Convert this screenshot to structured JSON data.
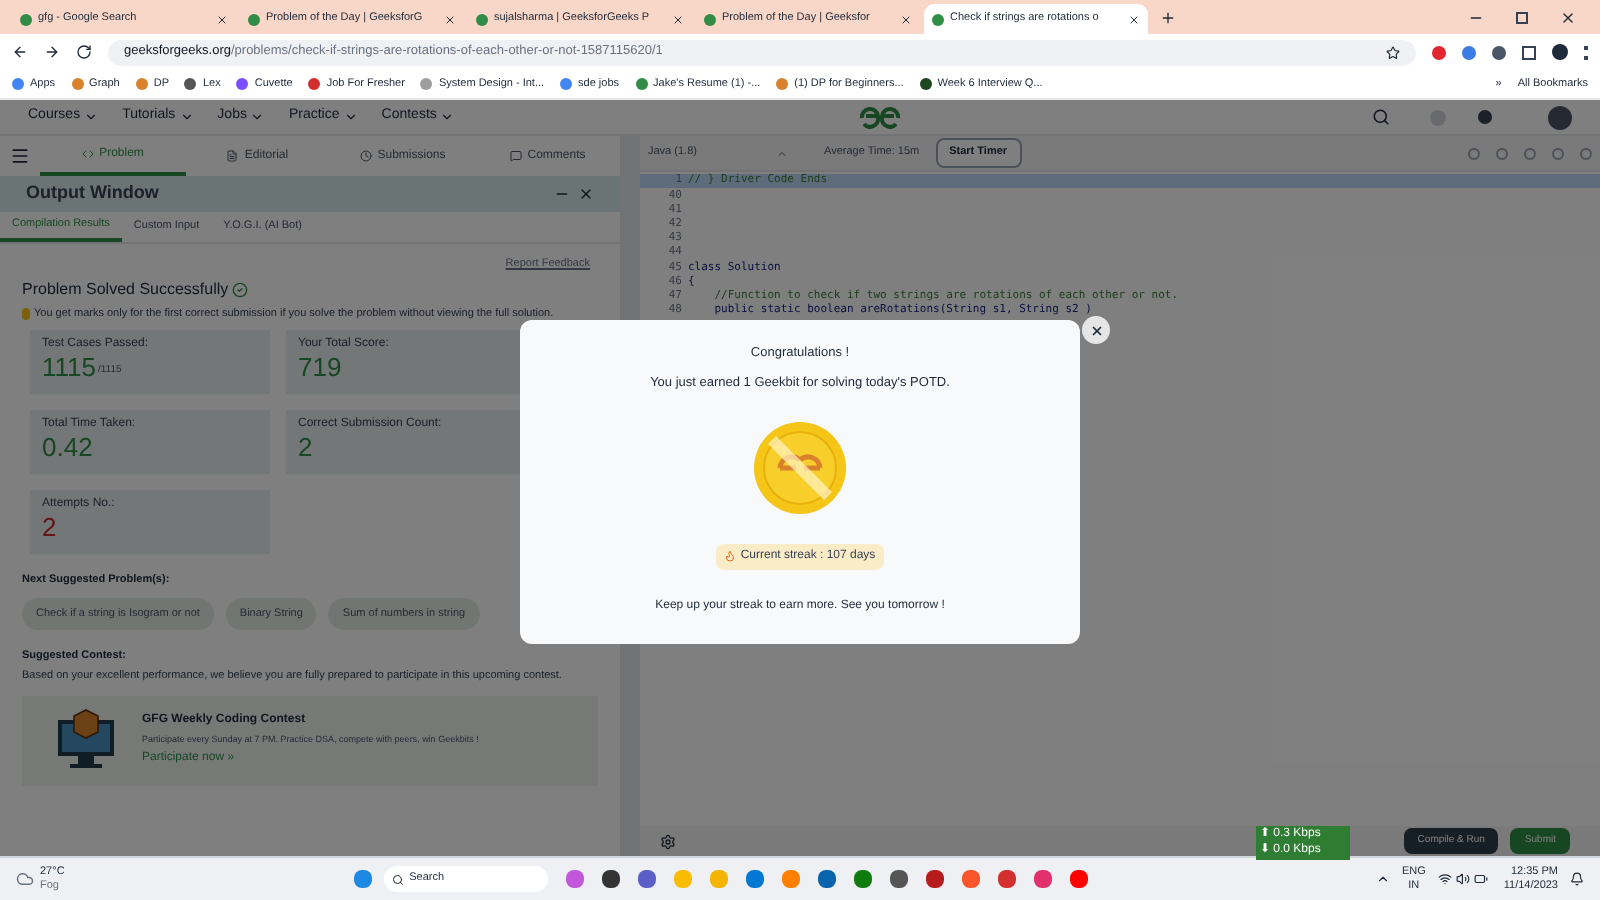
{
  "browser": {
    "tabs": [
      {
        "title": "gfg - Google Search",
        "selected": false
      },
      {
        "title": "Problem of the Day | GeeksforG",
        "selected": false
      },
      {
        "title": "sujalsharma | GeeksforGeeks P",
        "selected": false
      },
      {
        "title": "Problem of the Day | Geeksfor",
        "selected": false
      },
      {
        "title": "Check if strings are rotations o",
        "selected": true
      }
    ],
    "url_domain": "geeksforgeeks.org",
    "url_path": "/problems/check-if-strings-are-rotations-of-each-other-or-not-1587115620/1",
    "bookmarks": [
      {
        "label": "Apps",
        "color": "#4285f4"
      },
      {
        "label": "Graph",
        "color": "#d9822b"
      },
      {
        "label": "DP",
        "color": "#d9822b"
      },
      {
        "label": "Lex",
        "color": "#555555"
      },
      {
        "label": "Cuvette",
        "color": "#7c4dff"
      },
      {
        "label": "Job For Fresher",
        "color": "#d32f2f"
      },
      {
        "label": "System Design - Int...",
        "color": "#9e9e9e"
      },
      {
        "label": "sde jobs",
        "color": "#4285f4"
      },
      {
        "label": "Jake's Resume (1) -...",
        "color": "#2f8d46"
      },
      {
        "label": "(1) DP for Beginners...",
        "color": "#d9822b"
      },
      {
        "label": "Week 6 Interview Q...",
        "color": "#1e4620"
      }
    ],
    "more": "»",
    "all_bookmarks": "All Bookmarks"
  },
  "nav": {
    "menus": [
      "Courses",
      "Tutorials",
      "Jobs",
      "Practice",
      "Contests"
    ]
  },
  "problem_tabs": [
    {
      "label": "Problem",
      "selected": true
    },
    {
      "label": "Editorial",
      "selected": false
    },
    {
      "label": "Submissions",
      "selected": false
    },
    {
      "label": "Comments",
      "selected": false
    }
  ],
  "output": {
    "title": "Output Window",
    "tabs": [
      {
        "label": "Compilation Results",
        "selected": true
      },
      {
        "label": "Custom Input",
        "selected": false
      },
      {
        "label": "Y.O.G.I. (AI Bot)",
        "selected": false
      }
    ],
    "feedback_link": "Report Feedback",
    "status": "Problem Solved Successfully",
    "note": "You get marks only for the first correct submission if you solve the problem without viewing the full solution.",
    "stats": [
      {
        "label": "Test Cases Passed:",
        "value": "1115",
        "suffix": "/1115",
        "kind": "good"
      },
      {
        "label": "Your Total Score:",
        "value": "719",
        "kind": "good"
      },
      {
        "label": "Total Time Taken:",
        "value": "0.42",
        "kind": "good"
      },
      {
        "label": "Correct Submission Count:",
        "value": "2",
        "kind": "good"
      },
      {
        "label": "Attempts No.:",
        "value": "2",
        "kind": "bad"
      }
    ]
  },
  "suggested": {
    "heading": "Next Suggested Problem(s):",
    "problems": [
      "Check if a string is Isogram or not",
      "Binary String",
      "Sum of numbers in string"
    ]
  },
  "contest_section": {
    "heading": "Suggested Contest:",
    "text": "Based on your excellent performance, we believe you are fully prepared to participate in this upcoming contest.",
    "card": {
      "title": "GFG Weekly Coding Contest",
      "description": "Participate every Sunday at 7 PM. Practice DSA, compete with peers, win Geekbits !",
      "link": "Participate now »"
    }
  },
  "editor": {
    "language": "Java (1.8)",
    "avg_time": "Average Time: 15m",
    "timer_button": "Start Timer",
    "lines": [
      {
        "number": "1",
        "code": "// } Driver Code Ends",
        "highlighted": true
      },
      {
        "number": "40",
        "highlighted": false
      },
      {
        "number": "41",
        "highlighted": false
      },
      {
        "number": "42",
        "highlighted": false
      },
      {
        "number": "43",
        "highlighted": false
      },
      {
        "number": "44",
        "highlighted": false
      },
      {
        "number": "45",
        "code": "class Solution",
        "highlighted": false
      },
      {
        "number": "46",
        "code": "{",
        "highlighted": false
      },
      {
        "number": "47",
        "code": "    //Function to check if two strings are rotations of each other or not.",
        "highlighted": false
      },
      {
        "number": "48",
        "code": "    public static boolean areRotations(String s1, String s2 )",
        "highlighted": false
      }
    ],
    "buttons": [
      "Compile & Run",
      "Submit"
    ]
  },
  "network": [
    "⬆ 0.3 Kbps",
    "⬇ 0.0 Kbps"
  ],
  "modal": {
    "title": "Congratulations !",
    "message": "You just earned 1 Geekbit for solving today's POTD.",
    "streak": "Current streak : 107 days",
    "footer": "Keep up your streak to earn more. See you tomorrow !"
  },
  "taskbar": {
    "temperature": "27°C",
    "condition": "Fog",
    "search": "Search",
    "lang": "ENG",
    "region": "IN",
    "time": "12:35 PM",
    "date": "11/14/2023"
  }
}
